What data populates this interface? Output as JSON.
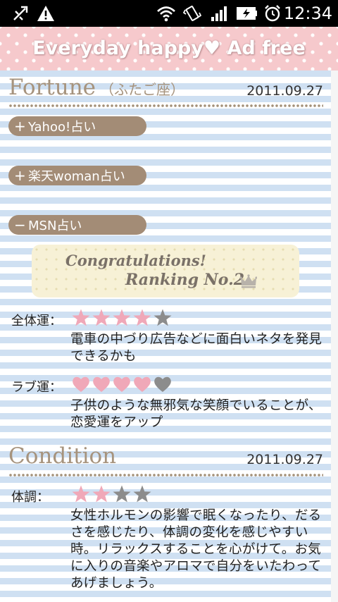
{
  "status_bar": {
    "time": "12:34",
    "icons": [
      "usb-debug-icon",
      "warning-icon",
      "wifi-icon",
      "vibrate-icon",
      "signal-icon",
      "battery-charging-icon",
      "alarm-icon"
    ]
  },
  "header": {
    "title": "Everyday happy♥ Ad free",
    "colors": {
      "background": "#f6c9cc",
      "text": "#ffffff"
    }
  },
  "fortune": {
    "title": "Fortune",
    "sign": "（ふたご座）",
    "date": "2011.09.27",
    "sources": [
      {
        "sign": "+",
        "label": "Yahoo!占い",
        "expanded": false
      },
      {
        "sign": "+",
        "label": "楽天woman占い",
        "expanded": false
      },
      {
        "sign": "−",
        "label": "MSN占い",
        "expanded": true
      }
    ],
    "banner": {
      "line1": "Congratulations!",
      "line2": "Ranking No.2",
      "rank": 2
    },
    "overall": {
      "label": "全体運：",
      "rating": 4,
      "max": 5,
      "icon": "star-icon",
      "text": "電車の中づり広告などに面白いネタを発見できるかも"
    },
    "love": {
      "label": "ラブ運：",
      "rating": 4,
      "max": 5,
      "icon": "heart-icon",
      "text": "子供のような無邪気な笑顔でいることが、恋愛運をアップ"
    }
  },
  "condition": {
    "title": "Condition",
    "date": "2011.09.27",
    "health": {
      "label": "体調：",
      "rating": 2,
      "max": 4,
      "icon": "star-icon",
      "text": "女性ホルモンの影響で眠くなったり、だるさを感じたり、体調の変化を感じやすい時。リラックスすることを心がけて。お気に入りの音楽やアロマで自分をいたわってあげましょう。"
    }
  },
  "colors": {
    "accent_brown": "#a38c76",
    "rating_on": "#f0a8b8",
    "rating_off": "#8c8c8c",
    "stripe_blue": "#cfe0f2"
  }
}
